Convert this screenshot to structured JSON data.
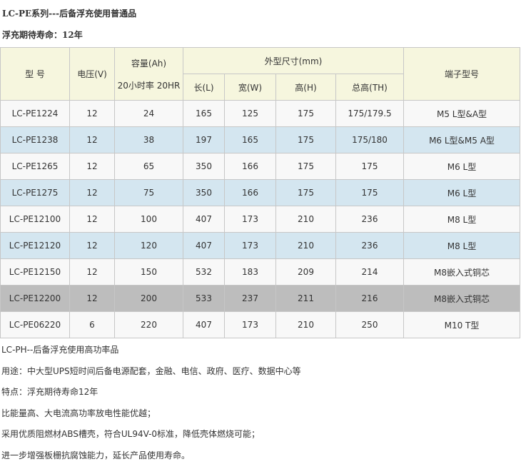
{
  "header": {
    "title": "LC-PE系列---后备浮充使用普通品",
    "life": "浮充期待寿命：12年"
  },
  "table": {
    "headers": {
      "model": "型 号",
      "voltage": "电压(V)",
      "capacity": "容量(Ah)",
      "capacity_rate": "20小时率  20HR",
      "dimensions": "外型尺寸(mm)",
      "length": "长(L)",
      "width": "宽(W)",
      "height": "高(H)",
      "total_height": "总高(TH)",
      "terminal": "端子型号"
    },
    "rows": [
      {
        "model": "LC-PE1224",
        "voltage": "12",
        "capacity": "24",
        "length": "165",
        "width": "125",
        "height": "175",
        "total_height": "175/179.5",
        "terminal": "M5 L型&A型"
      },
      {
        "model": "LC-PE1238",
        "voltage": "12",
        "capacity": "38",
        "length": "197",
        "width": "165",
        "height": "175",
        "total_height": "175/180",
        "terminal": "M6 L型&M5 A型"
      },
      {
        "model": "LC-PE1265",
        "voltage": "12",
        "capacity": "65",
        "length": "350",
        "width": "166",
        "height": "175",
        "total_height": "175",
        "terminal": "M6 L型"
      },
      {
        "model": "LC-PE1275",
        "voltage": "12",
        "capacity": "75",
        "length": "350",
        "width": "166",
        "height": "175",
        "total_height": "175",
        "terminal": "M6 L型"
      },
      {
        "model": "LC-PE12100",
        "voltage": "12",
        "capacity": "100",
        "length": "407",
        "width": "173",
        "height": "210",
        "total_height": "236",
        "terminal": "M8 L型"
      },
      {
        "model": "LC-PE12120",
        "voltage": "12",
        "capacity": "120",
        "length": "407",
        "width": "173",
        "height": "210",
        "total_height": "236",
        "terminal": "M8 L型"
      },
      {
        "model": "LC-PE12150",
        "voltage": "12",
        "capacity": "150",
        "length": "532",
        "width": "183",
        "height": "209",
        "total_height": "214",
        "terminal": "M8嵌入式铜芯"
      },
      {
        "model": "LC-PE12200",
        "voltage": "12",
        "capacity": "200",
        "length": "533",
        "width": "237",
        "height": "211",
        "total_height": "216",
        "terminal": "M8嵌入式铜芯"
      },
      {
        "model": "LC-PE06220",
        "voltage": "6",
        "capacity": "220",
        "length": "407",
        "width": "173",
        "height": "210",
        "total_height": "250",
        "terminal": "M10 T型"
      }
    ]
  },
  "notes": [
    "LC-PH--后备浮充使用高功率品",
    "用途：中大型UPS短时间后备电源配套，金融、电信、政府、医疗、数据中心等",
    "特点：浮充期待寿命12年",
    "比能量高、大电流高功率放电性能优越；",
    "采用优质阻燃材ABS槽壳，符合UL94V-0标准，降低壳体燃烧可能；",
    "进一步增强板栅抗腐蚀能力，延长产品使用寿命。"
  ],
  "colors": {
    "header_bg": "#f6f6de",
    "row_white": "#f8f8f8",
    "row_blue": "#d4e6f0",
    "row_gray": "#bdbdbd",
    "border": "#c7c7c7"
  }
}
